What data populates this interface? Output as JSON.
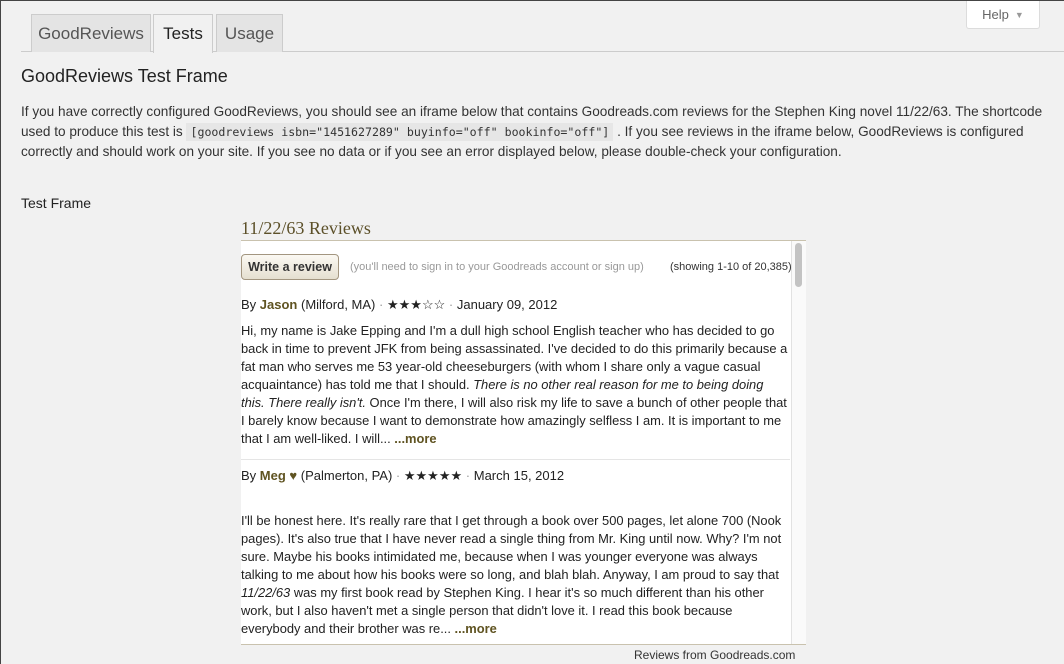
{
  "help": {
    "label": "Help"
  },
  "tabs": [
    {
      "label": "GoodReviews"
    },
    {
      "label": "Tests"
    },
    {
      "label": "Usage"
    }
  ],
  "page_title": "GoodReviews Test Frame",
  "description": {
    "part1": "If you have correctly configured GoodReviews, you should see an iframe below that contains Goodreads.com reviews for the Stephen King novel 11/22/63. The shortcode used to produce this test is ",
    "shortcode": "[goodreviews isbn=\"1451627289\" buyinfo=\"off\" bookinfo=\"off\"]",
    "part2": " . If you see reviews in the iframe below, GoodReviews is configured correctly and should work on your site. If you see no data or if you see an error displayed below, please double-check your configuration."
  },
  "test_frame_label": "Test Frame",
  "widget": {
    "title": "11/22/63 Reviews",
    "write_review": "Write a review",
    "signin_note": "(you'll need to sign in to your Goodreads account or sign up)",
    "showing": "(showing 1-10 of 20,385)",
    "footer": "Reviews from Goodreads.com",
    "reviews": [
      {
        "by": "By",
        "author": "Jason",
        "location": "(Milford, MA)",
        "stars": "★★★☆☆",
        "rating": 3,
        "date": "January 09, 2012",
        "text_a": "Hi, my name is Jake Epping and I'm a dull high school English teacher who has decided to go back in time to prevent JFK from being assassinated. I've decided to do this primarily because a fat man who serves me 53 year-old cheeseburgers (with whom I share only a vague casual acquaintance) has told me that I should. ",
        "text_italic": "There is no other real reason for me to being doing this. There really isn't.",
        "text_b": " Once I'm there, I will also risk my life to save a bunch of other people that I barely know because I want to demonstrate how amazingly selfless I am. It is important to me that I am well-liked. I will... ",
        "more": "...more"
      },
      {
        "by": "By",
        "author": "Meg",
        "heart": "♥",
        "location": "(Palmerton, PA)",
        "stars": "★★★★★",
        "rating": 5,
        "date": "March 15, 2012",
        "text_a": "I'll be honest here. It's really rare that I get through a book over 500 pages, let alone 700 (Nook pages). It's also true that I have never read a single thing from Mr. King until now. Why? I'm not sure. Maybe his books intimidated me, because when I was younger everyone was always talking to me about how his books were so long, and blah blah. Anyway, I am proud to say that ",
        "text_italic": "11/22/63",
        "text_b": " was my first book read by Stephen King. I hear it's so much different than his other work, but I also haven't met a single person that didn't love it. I read this book because everybody and their brother was re... ",
        "more": "...more"
      }
    ]
  }
}
